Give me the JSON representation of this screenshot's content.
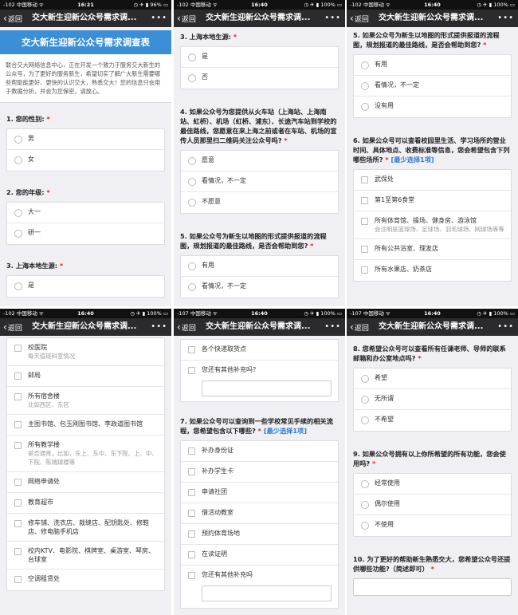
{
  "nav": {
    "back_label": "返回",
    "title": "交大新生迎新公众号需求调...",
    "more": "•••"
  },
  "statusbars": [
    {
      "left": "-102 中国移动 ᯤ",
      "time": "16:21",
      "right": "◷ ✈ ▮ 96% ▭"
    },
    {
      "left": "-102 中国移动 ᯤ",
      "time": "16:40",
      "right": "◷ ✈ ▮ 100% ▭"
    },
    {
      "left": "-102 中国移动 ᯤ",
      "time": "16:40",
      "right": "◷ ✈ ▮ 100% ▭"
    },
    {
      "left": "-102 中国移动 ᯤ",
      "time": "16:40",
      "right": "◷ ✈ ▮ 100% ▭"
    },
    {
      "left": "-107 中国移动 ᯤ",
      "time": "16:40",
      "right": "◷ ✈ ▮ 100% ▭"
    },
    {
      "left": "-107 中国移动 ᯤ",
      "time": "16:40",
      "right": "◷ ✈ ▮ 100% ▭"
    }
  ],
  "survey": {
    "banner_title": "交大新生迎新公众号需求调查表",
    "intro": "联合交大网络信息中心，正在开发一个致力于服务交大新生的公众号，为了更好的服务新生，希望切实了解广大新生需要哪些帮助能更好、更快的认识交大，熟悉交大！您的信息只会用于数据分析，并会为您保密，请放心。",
    "required_mark": "*",
    "q1": {
      "title": "1. 您的性别:",
      "options": [
        "男",
        "女"
      ]
    },
    "q2": {
      "title": "2. 您的年级:",
      "options": [
        "大一",
        "研一"
      ]
    },
    "q3": {
      "title": "3. 上海本地生源:",
      "options": [
        "是",
        "否"
      ]
    },
    "q4": {
      "title": "4. 如果公众号为您提供从火车站（上海站、上海南站、虹桥）、机场（虹桥、浦东）、长途汽车站到学校的最佳路线，您愿意在来上海之前或者在车站、机场的宣传人员那里扫二维码关注公众号吗?",
      "options": [
        "愿意",
        "看情况，不一定",
        "不愿意"
      ]
    },
    "q5": {
      "title": "5. 如果公众号为新生以地图的形式提供报道的流程图，规划报道的最佳路线，是否会帮助到您?",
      "options": [
        "有用",
        "看情况，不一定",
        "没有用"
      ]
    },
    "q6": {
      "title": "6. 如果公众号可以查看校园里生活、学习场所的营业时间、具体地点、收费标准等信息，您会希望包含下列哪些场所?",
      "hint": "[最少选择1项]",
      "options": [
        {
          "label": "武保处"
        },
        {
          "label": "第1至第6食堂"
        },
        {
          "label": "所有体育馆、操场、健身房、游泳馆",
          "sub": "会注明是篮球场、足球场、羽毛球场、网球场等等"
        },
        {
          "label": "所有公共浴室、理发店"
        },
        {
          "label": "所有水果店、奶茶店"
        },
        {
          "label": "校医院",
          "sub": "每天值班科室情况"
        },
        {
          "label": "邮局"
        },
        {
          "label": "所有宿舍楼",
          "sub": "比如西区、东区"
        },
        {
          "label": "主图书馆、包玉刚图书馆、李政道图书馆"
        },
        {
          "label": "所有教学楼",
          "sub": "是否通宵。比如，东上、东中、东下院、上、中、下院、陈瑞球楼等"
        },
        {
          "label": "网络申请处"
        },
        {
          "label": "教育超市"
        },
        {
          "label": "修车铺、洗衣店、裁缝店、配钥匙处、修鞋店、修电脑手机店"
        },
        {
          "label": "校内KTV、电影院、棋牌室、桌游室、琴房、台球室"
        },
        {
          "label": "空调租赁处"
        },
        {
          "label": "各个快递取货点"
        },
        {
          "label": "您还有其他补充吗?"
        }
      ]
    },
    "q7": {
      "title": "7. 如果公众号可以查询到一些学校常见手续的相关流程，您希望包含以下哪些?",
      "hint": "[最少选择1项]",
      "options": [
        "补办身份证",
        "补办学生卡",
        "申请社团",
        "借活动教室",
        "预约体育场地",
        "在读证明",
        "您还有其他补充吗"
      ]
    },
    "q8": {
      "title": "8. 您希望公众号可以查看所有任课老师、导师的联系邮箱和办公室地点吗?",
      "options": [
        "希望",
        "无所谓",
        "不希望"
      ]
    },
    "q9": {
      "title": "9. 如果公众号拥有以上你所希望的所有功能，您会使用吗?",
      "options": [
        "经常使用",
        "偶尔使用",
        "不使用"
      ]
    },
    "q10": {
      "title": "10. 为了更好的帮助新生熟悉交大，您希望公众号还提供哪些功能?（简述即可）"
    }
  }
}
